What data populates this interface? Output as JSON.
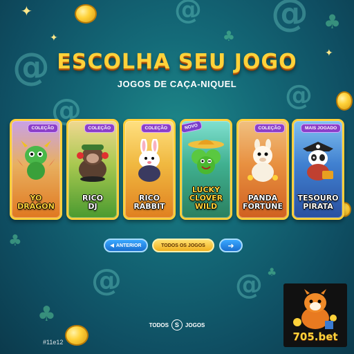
{
  "header": {
    "title": "ESCOLHA SEU JOGO",
    "subtitle": "JOGOS DE CAÇA-NIQUEL"
  },
  "games": [
    {
      "label": "YO\nDRAGON",
      "badge": "COLEÇÃO",
      "theme": "#e89020",
      "character": "dragon-icon"
    },
    {
      "label": "RICO\nDJ",
      "badge": "COLEÇÃO",
      "theme": "#5aa830",
      "character": "gorilla-icon"
    },
    {
      "label": "RICO\nRABBIT",
      "badge": "COLEÇÃO",
      "theme": "#f0a020",
      "character": "rabbit-icon"
    },
    {
      "label": "LUCKY\nCLOVER\nWILD",
      "badge": "NOVO",
      "theme": "#2a9a80",
      "character": "clover-icon"
    },
    {
      "label": "PANDA\nFORTUNE",
      "badge": "COLEÇÃO",
      "theme": "#e06a20",
      "character": "llama-icon"
    },
    {
      "label": "TESOURO\nPIRATA",
      "badge": "MAIS JOGADO",
      "theme": "#2a6ad0",
      "character": "panda-pirate-icon"
    }
  ],
  "navigation": {
    "prev_label": "ANTERIOR",
    "all_label": "TODOS OS JOGOS",
    "next_icon": "arrow-right-icon"
  },
  "footer": {
    "link_left": "TODOS",
    "link_icon": "S",
    "link_right": "JOGOS",
    "hashtag": "#11e12"
  },
  "brand": {
    "logo_text": "705.bet"
  },
  "colors": {
    "accent_gold": "#ffd23a",
    "button_blue": "#1a6fd0",
    "badge_purple": "#8b3fc9"
  }
}
